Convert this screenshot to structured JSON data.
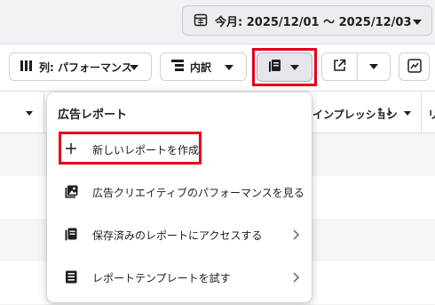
{
  "date_range": {
    "label": "今月: 2025/12/01 ～ 2025/12/03",
    "icon": "calendar-icon"
  },
  "toolbar": {
    "columns_label": "列: パフォーマンス",
    "breakdown_label": "内訳",
    "reports_icon": "reports-icon",
    "share_icon": "share-icon",
    "chart_icon": "chart-icon"
  },
  "table": {
    "header_impressions": "インプレッション",
    "header_impressions_sort": "↑↓",
    "header_next": "リ"
  },
  "reports_menu": {
    "title": "広告レポート",
    "items": [
      {
        "label": "新しいレポートを作成",
        "icon": "plus-icon",
        "has_submenu": false
      },
      {
        "label": "広告クリエイティブのパフォーマンスを見る",
        "icon": "image-icon",
        "has_submenu": false
      },
      {
        "label": "保存済みのレポートにアクセスする",
        "icon": "saved-reports-icon",
        "has_submenu": true
      },
      {
        "label": "レポートテンプレートを試す",
        "icon": "template-icon",
        "has_submenu": true
      }
    ]
  },
  "colors": {
    "highlight": "#e0001b",
    "accent": "#1c1e21"
  }
}
